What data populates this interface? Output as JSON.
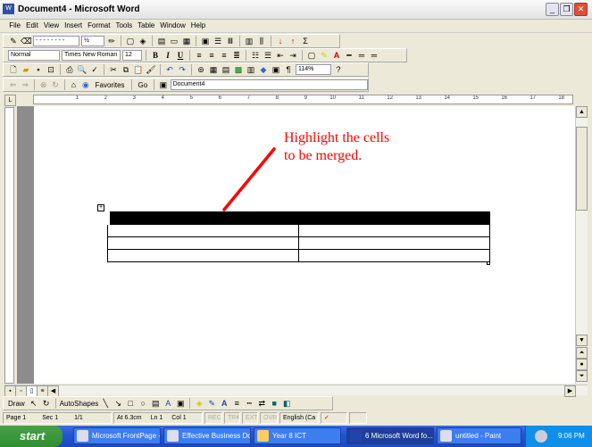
{
  "window": {
    "title": "Document4 - Microsoft Word",
    "app_icon": "W"
  },
  "menu": [
    "File",
    "Edit",
    "View",
    "Insert",
    "Format",
    "Tools",
    "Table",
    "Window",
    "Help"
  ],
  "toolbars": {
    "tables_borders": {
      "line_style": "- - - - - - - -",
      "line_weight": "½"
    },
    "formatting": {
      "style": "Normal",
      "font": "Times New Roman",
      "size": "12",
      "bold": "B",
      "italic": "I",
      "underline": "U"
    },
    "standard": {
      "zoom": "114%",
      "pilcrow": "¶"
    },
    "web": {
      "favorites": "Favorites",
      "go": "Go",
      "address": "Document4"
    }
  },
  "ruler": {
    "labels": [
      "1",
      "2",
      "3",
      "4",
      "5",
      "6",
      "7",
      "8",
      "9",
      "10",
      "11",
      "12",
      "13",
      "14",
      "15",
      "16",
      "17",
      "18"
    ]
  },
  "document": {
    "annotation_line1": "Highlight the cells",
    "annotation_line2": "to be merged.",
    "annotation_color": "#ff0000",
    "table_rows": 4,
    "table_cols": 2,
    "selected_row": 1
  },
  "drawing": {
    "draw": "Draw",
    "autoshapes": "AutoShapes"
  },
  "status": {
    "page": "Page 1",
    "sec": "Sec 1",
    "pages": "1/1",
    "at": "At 6.3cm",
    "ln": "Ln 1",
    "col": "Col 1",
    "rec": "REC",
    "trk": "TRK",
    "ext": "EXT",
    "ovr": "OVR",
    "language": "English (Ca"
  },
  "taskbar": {
    "start": "start",
    "tasks": [
      "Microsoft FrontPage -...",
      "Effective Business Do...",
      "Year 8 ICT",
      "6 Microsoft Word fo...",
      "untitled - Paint"
    ],
    "clock": "9:06 PM"
  }
}
